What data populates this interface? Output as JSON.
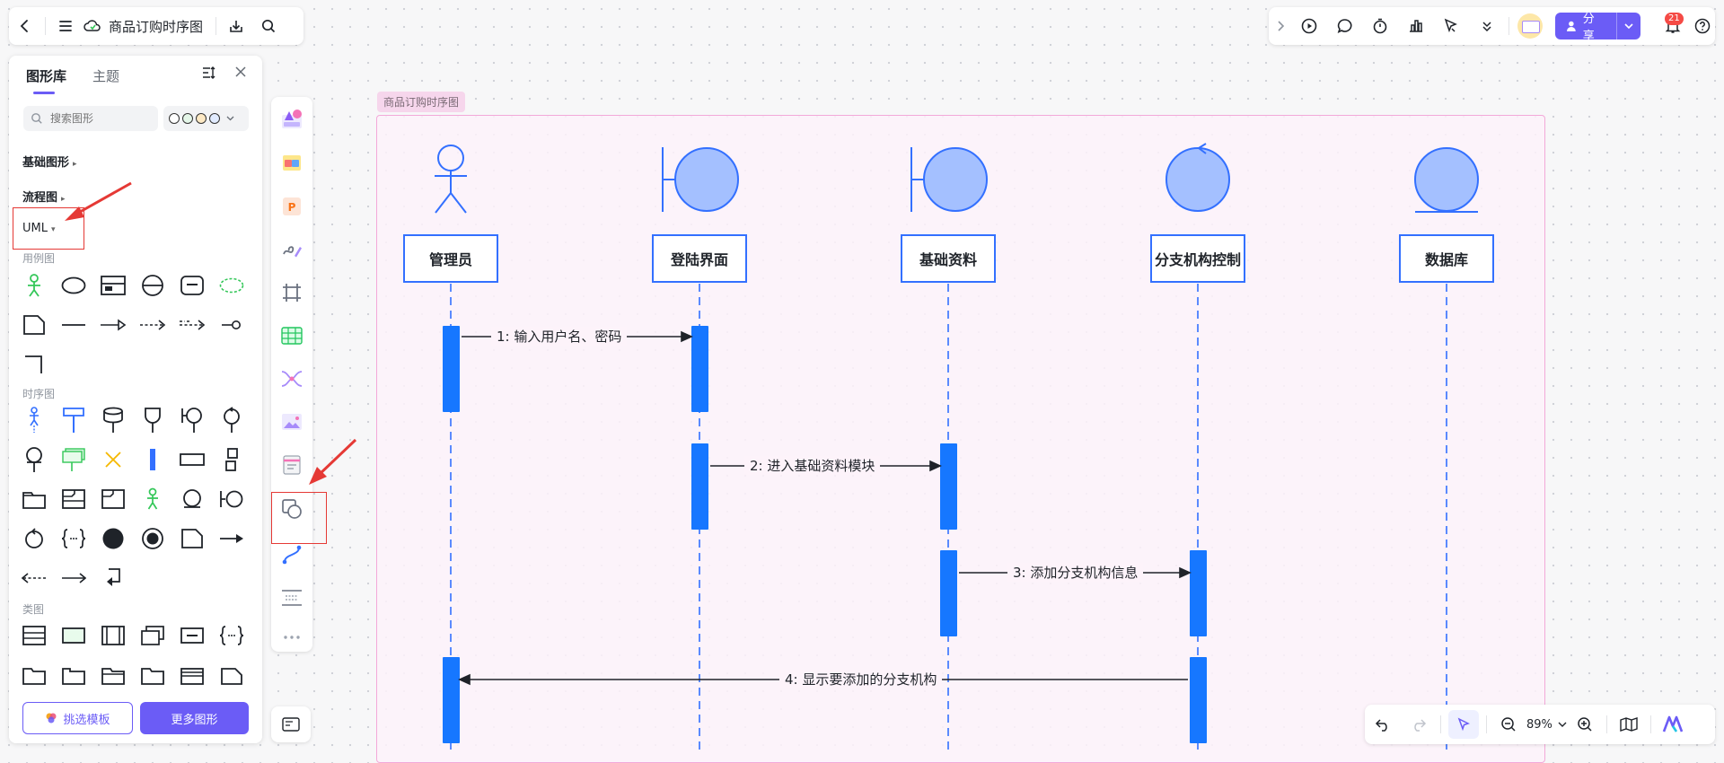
{
  "topbar": {
    "doc_title": "商品订购时序图",
    "icons": [
      "back-icon",
      "menu-icon",
      "cloud-sync-icon",
      "download-icon",
      "search-icon"
    ]
  },
  "topright": {
    "share_label": "分享",
    "notification_count": "21",
    "icons": [
      "expand-icon",
      "present-icon",
      "comment-icon",
      "timer-icon",
      "vote-icon",
      "laser-icon",
      "more-icon",
      "avatar",
      "notification-icon",
      "help-icon"
    ]
  },
  "panel": {
    "tabs": [
      "图形库",
      "主题"
    ],
    "active_tab": "图形库",
    "search_placeholder": "搜索图形",
    "categories": [
      "基础图形",
      "流程图",
      "UML"
    ],
    "subsections": [
      "用例图",
      "时序图",
      "类图"
    ],
    "buttons": {
      "template": "挑选模板",
      "more": "更多图形"
    },
    "colors": {
      "accent": "#6b5cf6",
      "blue": "#3370ff",
      "green": "#34c759"
    }
  },
  "canvas": {
    "frame_label": "商品订购时序图",
    "lifelines": [
      "管理员",
      "登陆界面",
      "基础资料",
      "分支机构控制",
      "数据库"
    ],
    "messages": [
      "1: 输入用户名、密码",
      "2: 进入基础资料模块",
      "3: 添加分支机构信息",
      "4: 显示要添加的分支机构"
    ]
  },
  "bottombar": {
    "zoom": "89%"
  }
}
